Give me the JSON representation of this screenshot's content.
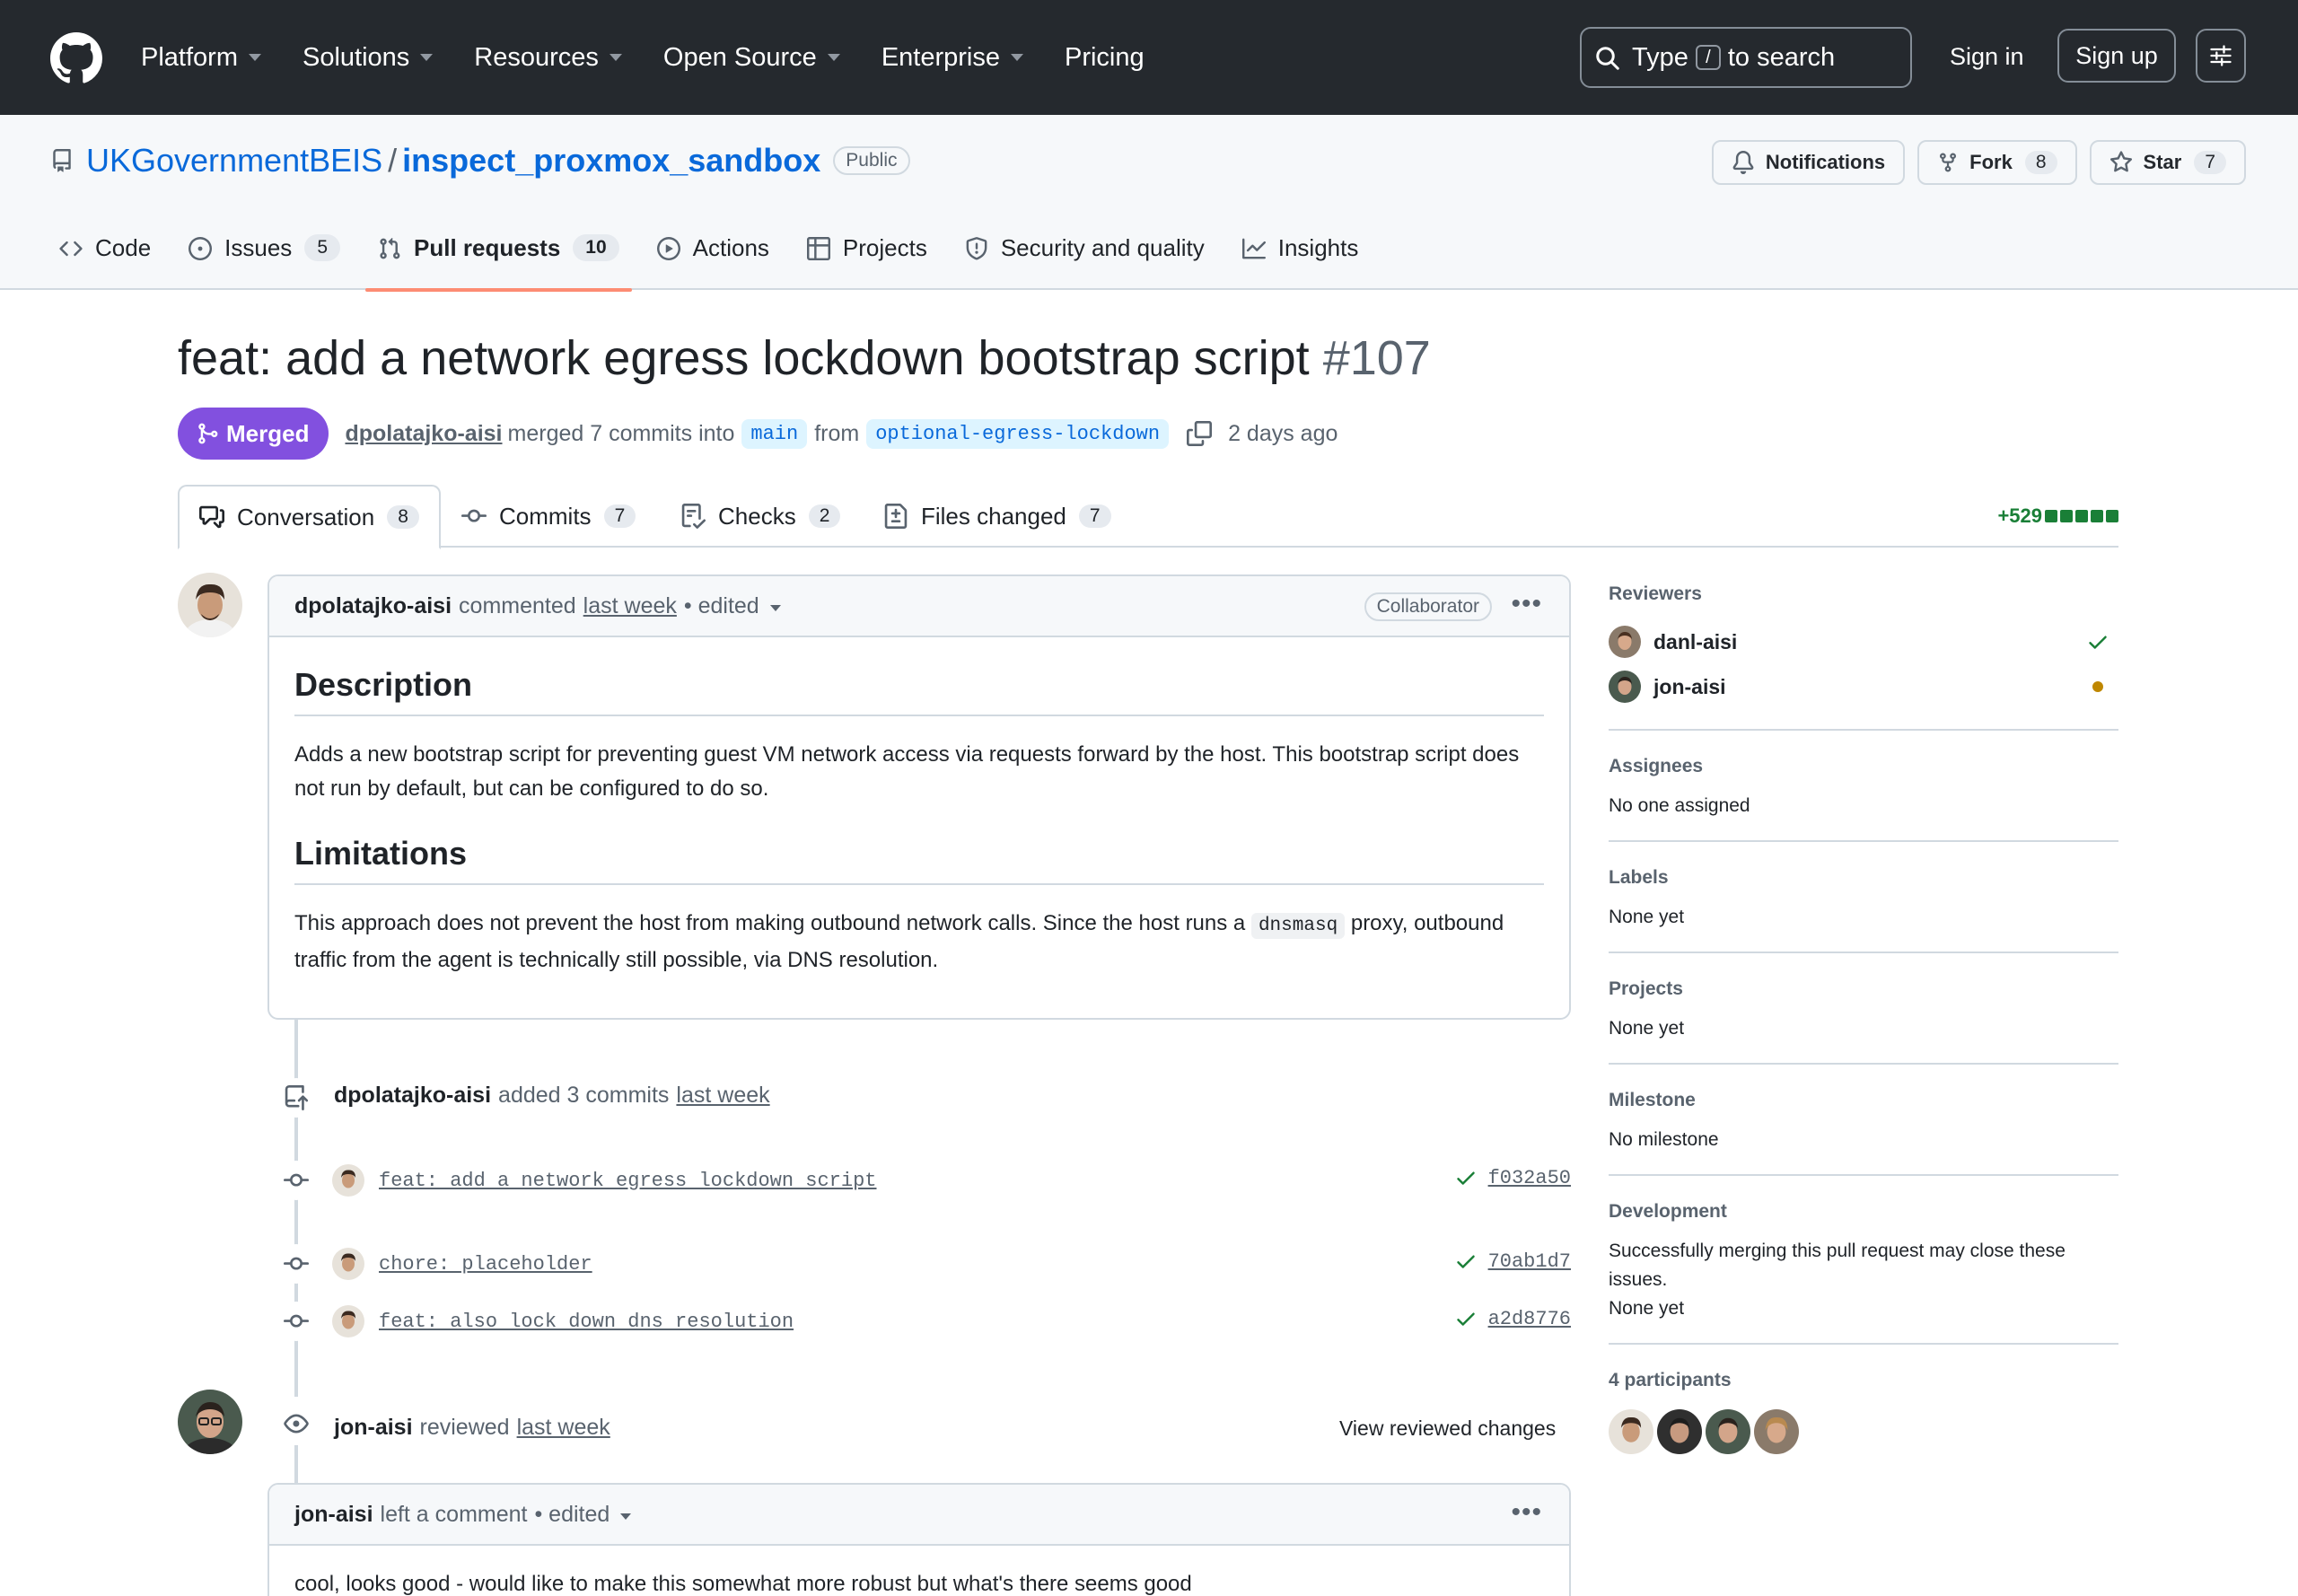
{
  "header": {
    "nav": [
      "Platform",
      "Solutions",
      "Resources",
      "Open Source",
      "Enterprise",
      "Pricing"
    ],
    "search": {
      "before": "Type",
      "key": "/",
      "after": "to search"
    },
    "sign_in": "Sign in",
    "sign_up": "Sign up"
  },
  "repo": {
    "owner": "UKGovernmentBEIS",
    "separator": "/",
    "name": "inspect_proxmox_sandbox",
    "visibility": "Public",
    "notifications": "Notifications",
    "fork_label": "Fork",
    "fork_count": "8",
    "star_label": "Star",
    "star_count": "7",
    "tabs": [
      {
        "label": "Code",
        "count": null
      },
      {
        "label": "Issues",
        "count": "5"
      },
      {
        "label": "Pull requests",
        "count": "10"
      },
      {
        "label": "Actions",
        "count": null
      },
      {
        "label": "Projects",
        "count": null
      },
      {
        "label": "Security and quality",
        "count": null
      },
      {
        "label": "Insights",
        "count": null
      }
    ]
  },
  "pr": {
    "title": "feat: add a network egress lockdown bootstrap script",
    "number": "#107",
    "state": "Merged",
    "author": "dpolatajko-aisi",
    "merged_text": "merged 7 commits into",
    "base_branch": "main",
    "from_text": "from",
    "head_branch": "optional-egress-lockdown",
    "time": "2 days ago",
    "tabs": [
      {
        "label": "Conversation",
        "count": "8"
      },
      {
        "label": "Commits",
        "count": "7"
      },
      {
        "label": "Checks",
        "count": "2"
      },
      {
        "label": "Files changed",
        "count": "7"
      }
    ],
    "additions": "+529"
  },
  "comment1": {
    "author": "dpolatajko-aisi",
    "action": "commented",
    "time": "last week",
    "edited": "• edited",
    "role": "Collaborator",
    "h_description": "Description",
    "p_description": "Adds a new bootstrap script for preventing guest VM network access via requests forward by the host. This bootstrap script does not run by default, but can be configured to do so.",
    "h_limitations": "Limitations",
    "p_limitations_before": "This approach does not prevent the host from making outbound network calls. Since the host runs a",
    "p_limitations_code": "dnsmasq",
    "p_limitations_after": "proxy, outbound traffic from the agent is technically still possible, via DNS resolution."
  },
  "commits_event": {
    "author": "dpolatajko-aisi",
    "action": "added 3 commits",
    "time": "last week",
    "commits": [
      {
        "message": "feat: add a network egress lockdown script",
        "sha": "f032a50"
      },
      {
        "message": "chore: placeholder",
        "sha": "70ab1d7"
      },
      {
        "message": "feat: also lock down dns resolution",
        "sha": "a2d8776"
      }
    ]
  },
  "review_event": {
    "author": "jon-aisi",
    "action": "reviewed",
    "time": "last week",
    "view_changes": "View reviewed changes"
  },
  "comment2": {
    "author": "jon-aisi",
    "action": "left a comment",
    "edited": "• edited",
    "body": "cool, looks good - would like to make this somewhat more robust but what's there seems good"
  },
  "sidebar": {
    "reviewers_heading": "Reviewers",
    "reviewers": [
      {
        "name": "danl-aisi",
        "status": "approved"
      },
      {
        "name": "jon-aisi",
        "status": "pending"
      }
    ],
    "assignees_heading": "Assignees",
    "assignees_value": "No one assigned",
    "labels_heading": "Labels",
    "labels_value": "None yet",
    "projects_heading": "Projects",
    "projects_value": "None yet",
    "milestone_heading": "Milestone",
    "milestone_value": "No milestone",
    "development_heading": "Development",
    "development_text": "Successfully merging this pull request may close these issues.",
    "development_value": "None yet",
    "participants_heading": "4 participants"
  },
  "colors": {
    "header_bg": "#25292e",
    "merged": "#8250df",
    "link": "#0969da",
    "success": "#1a7f37",
    "pending": "#bf8700",
    "tab_underline": "#fd8c73"
  }
}
